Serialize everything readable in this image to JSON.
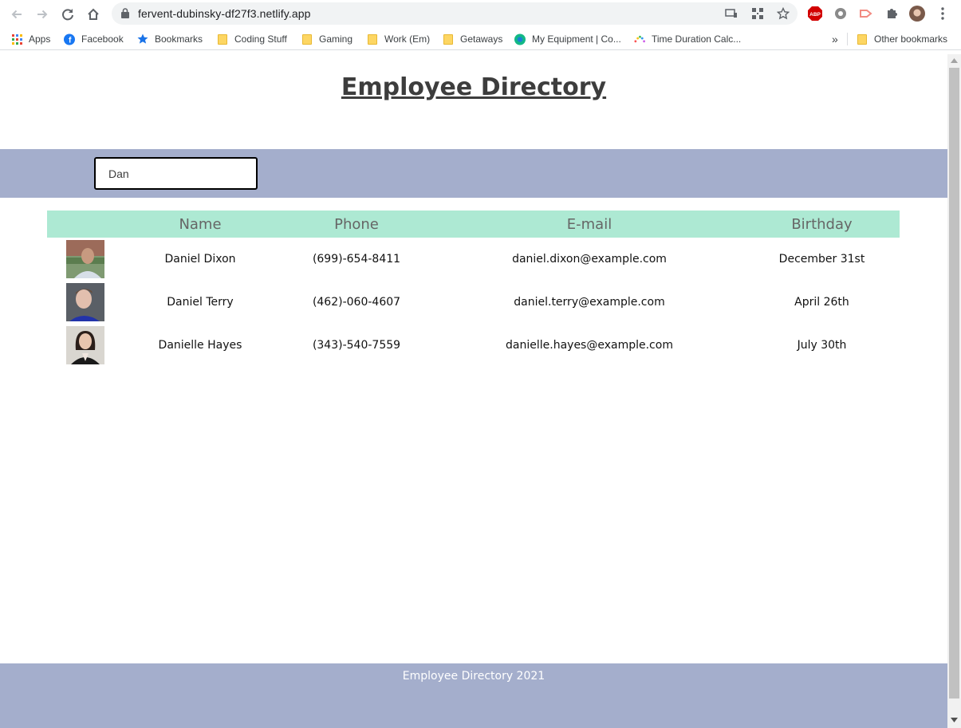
{
  "browser": {
    "url": "fervent-dubinsky-df27f3.netlify.app",
    "bookmarks": [
      {
        "label": "Apps",
        "icon": "apps-grid-icon"
      },
      {
        "label": "Facebook",
        "icon": "facebook-icon"
      },
      {
        "label": "Bookmarks",
        "icon": "star-icon"
      },
      {
        "label": "Coding Stuff",
        "icon": "folder-icon"
      },
      {
        "label": "Gaming",
        "icon": "folder-icon"
      },
      {
        "label": "Work (Em)",
        "icon": "folder-icon"
      },
      {
        "label": "Getaways",
        "icon": "folder-icon"
      },
      {
        "label": "My Equipment | Co...",
        "icon": "site-icon"
      },
      {
        "label": "Time Duration Calc...",
        "icon": "site-icon"
      }
    ],
    "overflow_label": "»",
    "other_bookmarks": "Other bookmarks"
  },
  "page": {
    "title": "Employee Directory",
    "search": {
      "value": "Dan"
    },
    "table": {
      "headers": [
        "",
        "Name",
        "Phone",
        "E-mail",
        "Birthday"
      ],
      "rows": [
        {
          "name": "Daniel Dixon",
          "phone": "(699)-654-8411",
          "email": "daniel.dixon@example.com",
          "birthday": "December 31st"
        },
        {
          "name": "Daniel Terry",
          "phone": "(462)-060-4607",
          "email": "daniel.terry@example.com",
          "birthday": "April 26th"
        },
        {
          "name": "Danielle Hayes",
          "phone": "(343)-540-7559",
          "email": "danielle.hayes@example.com",
          "birthday": "July 30th"
        }
      ]
    },
    "footer": "Employee Directory 2021"
  },
  "colors": {
    "band": "#a4aecc",
    "table_header": "#ade9d3",
    "title": "#3d3d3d"
  }
}
